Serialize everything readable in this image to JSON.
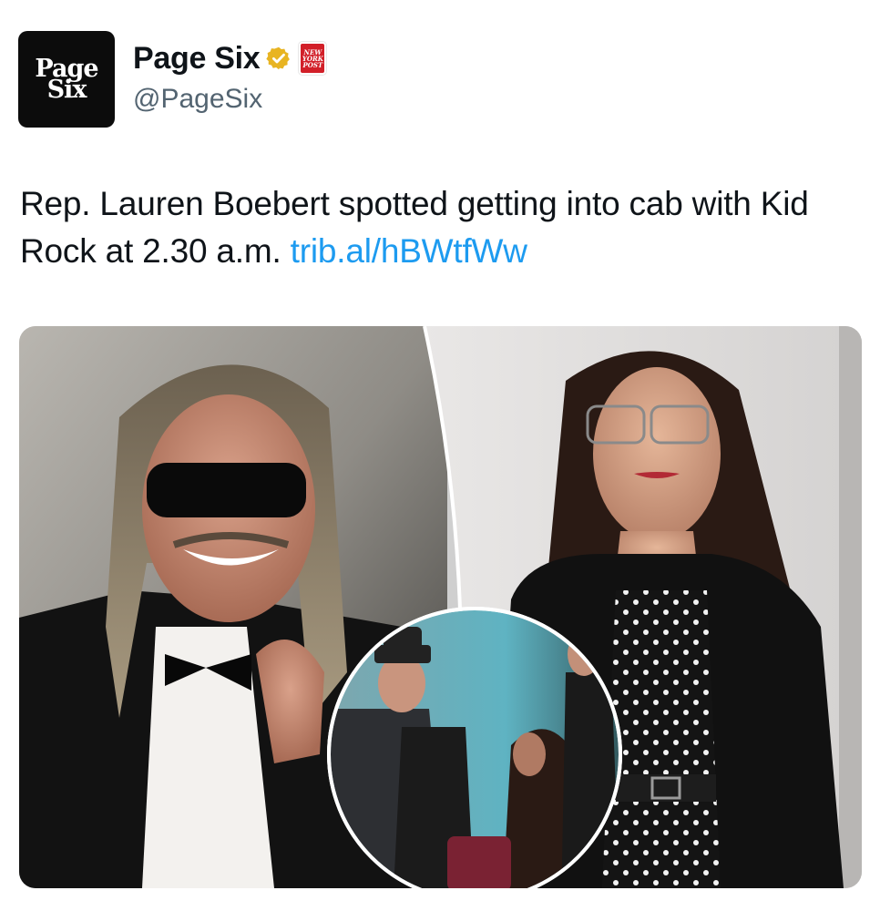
{
  "account": {
    "avatar_text_line1": "Page",
    "avatar_text_line2": "Six",
    "display_name": "Page Six",
    "handle": "@PageSix",
    "affiliate_badge_lines": [
      "NEW",
      "YORK",
      "POST"
    ]
  },
  "tweet": {
    "text": "Rep. Lauren Boebert spotted getting into cab with Kid Rock at 2.30 a.m. ",
    "link": "trib.al/hBWtfWw"
  },
  "colors": {
    "link": "#1d9bf0",
    "verified_badge": "#e8b422",
    "affiliate_badge": "#d21f28",
    "handle": "#536471"
  }
}
